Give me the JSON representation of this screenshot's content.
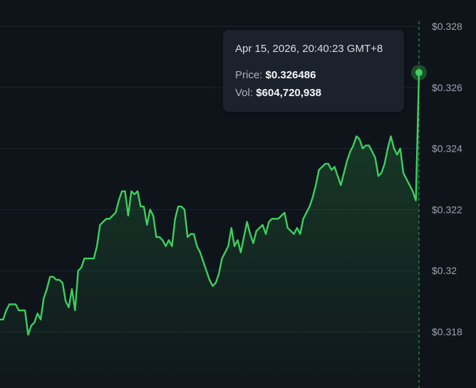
{
  "tooltip": {
    "date": "Apr 15, 2026, 20:40:23 GMT+8",
    "price_label": "Price:",
    "price_value": "$0.326486",
    "vol_label": "Vol:",
    "vol_value": "$604,720,938"
  },
  "colors": {
    "background": "#0f141b",
    "line": "#3ecf5e",
    "grid": "#1f2630",
    "tooltip_bg": "#1c222b"
  },
  "chart_data": {
    "type": "area",
    "title": "",
    "xlabel": "",
    "ylabel": "",
    "ylim": [
      0.3165,
      0.328
    ],
    "y_ticks": [
      0.318,
      0.32,
      0.322,
      0.324,
      0.326,
      0.328
    ],
    "y_tick_labels": [
      "$0.318",
      "$0.32",
      "$0.322",
      "$0.324",
      "$0.326",
      "$0.328"
    ],
    "grid": true,
    "hover_index": 134,
    "hover_value": 0.326486,
    "series": [
      {
        "values": [
          0.3184,
          0.3184,
          0.3187,
          0.3189,
          0.3189,
          0.3189,
          0.3187,
          0.3187,
          0.3187,
          0.3179,
          0.3182,
          0.3183,
          0.3186,
          0.3184,
          0.3191,
          0.3194,
          0.3198,
          0.3198,
          0.3197,
          0.3197,
          0.3196,
          0.319,
          0.3188,
          0.3194,
          0.3187,
          0.32,
          0.3201,
          0.3204,
          0.3204,
          0.3204,
          0.3204,
          0.3208,
          0.3215,
          0.3216,
          0.3217,
          0.3217,
          0.3218,
          0.3219,
          0.3223,
          0.3226,
          0.3226,
          0.3218,
          0.3226,
          0.3225,
          0.3226,
          0.3221,
          0.3221,
          0.3215,
          0.322,
          0.3218,
          0.3211,
          0.3211,
          0.321,
          0.3208,
          0.321,
          0.3208,
          0.3217,
          0.3221,
          0.3221,
          0.322,
          0.3211,
          0.3212,
          0.3212,
          0.3208,
          0.3206,
          0.3203,
          0.32,
          0.3197,
          0.3195,
          0.3196,
          0.3199,
          0.3204,
          0.3206,
          0.3208,
          0.3214,
          0.3208,
          0.321,
          0.3206,
          0.3211,
          0.3216,
          0.3212,
          0.3209,
          0.3213,
          0.3214,
          0.3215,
          0.3212,
          0.3216,
          0.3217,
          0.3217,
          0.3217,
          0.3218,
          0.3219,
          0.3214,
          0.3213,
          0.3212,
          0.3214,
          0.3212,
          0.3217,
          0.3219,
          0.3221,
          0.3224,
          0.3228,
          0.3233,
          0.3234,
          0.3235,
          0.3235,
          0.3233,
          0.3234,
          0.3231,
          0.3228,
          0.3232,
          0.3236,
          0.3239,
          0.3241,
          0.3244,
          0.3243,
          0.324,
          0.3241,
          0.3241,
          0.3239,
          0.3237,
          0.3231,
          0.3232,
          0.3235,
          0.324,
          0.3244,
          0.324,
          0.3238,
          0.324,
          0.3232,
          0.323,
          0.3228,
          0.3226,
          0.3223,
          0.326486
        ]
      }
    ]
  }
}
